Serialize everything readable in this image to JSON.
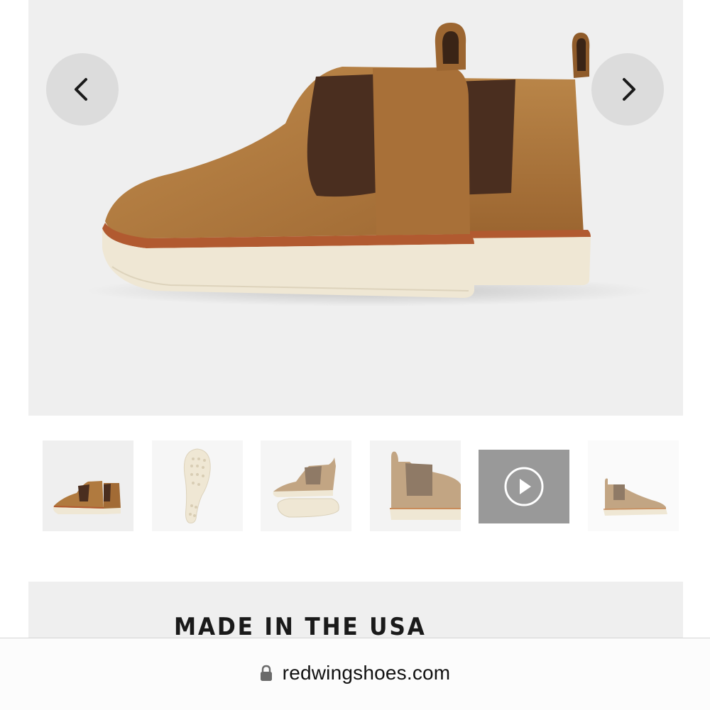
{
  "gallery": {
    "prev_icon": "chevron-left-icon",
    "next_icon": "chevron-right-icon",
    "thumbnails": [
      {
        "kind": "image",
        "icon": "boots-pair-back-thumbnail"
      },
      {
        "kind": "image",
        "icon": "outsole-thumbnail"
      },
      {
        "kind": "image",
        "icon": "boot-side-and-sole-thumbnail"
      },
      {
        "kind": "image",
        "icon": "boot-back-heel-thumbnail"
      },
      {
        "kind": "video",
        "icon": "play-icon"
      },
      {
        "kind": "image",
        "icon": "boot-profile-thumbnail"
      }
    ]
  },
  "section": {
    "title": "MADE IN THE USA"
  },
  "browser": {
    "url": "redwingshoes.com",
    "lock_icon": "lock-icon"
  },
  "colors": {
    "suede": "#a8743a",
    "elastic": "#4a2e1f",
    "sole": "#efe7d4",
    "welt": "#b15a30",
    "panel": "#efefef",
    "video_tile": "#999999"
  }
}
